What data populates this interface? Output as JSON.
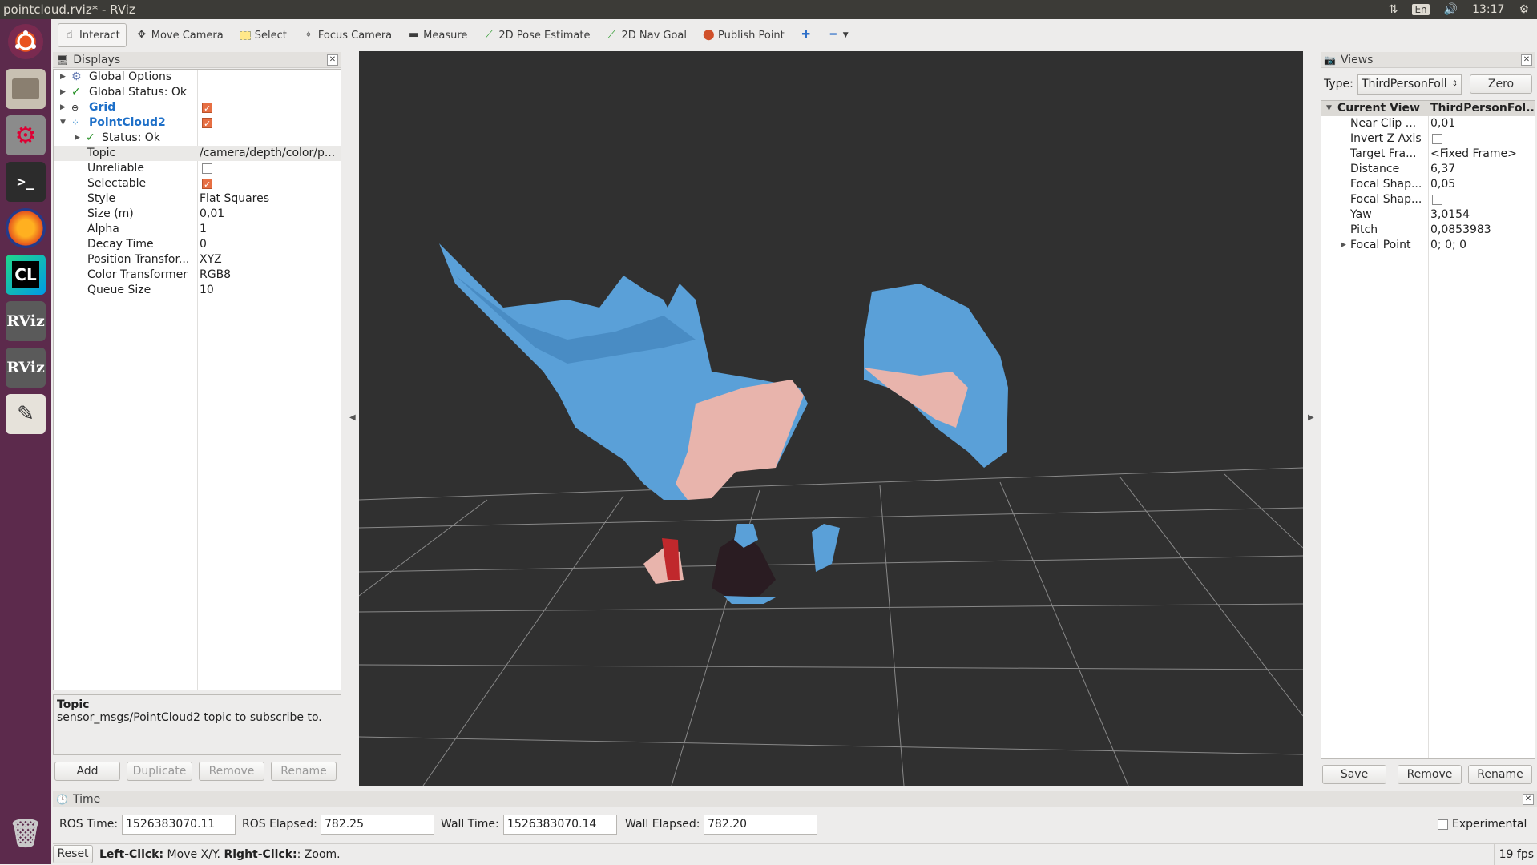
{
  "window": {
    "title": "pointcloud.rviz* - RViz"
  },
  "tray": {
    "language": "En",
    "clock": "13:17"
  },
  "launcher": {
    "items": [
      "ubuntu-icon",
      "files-icon",
      "settings-icon",
      "terminal-icon",
      "firefox-icon",
      "clion-icon",
      "rviz-icon",
      "rviz-icon",
      "text-editor-icon",
      "trash-icon"
    ],
    "clion_label": "CL",
    "rviz_label": "RViz"
  },
  "toolbar": {
    "interact": "Interact",
    "move_camera": "Move Camera",
    "select": "Select",
    "focus_camera": "Focus Camera",
    "measure": "Measure",
    "pose_estimate": "2D Pose Estimate",
    "nav_goal": "2D Nav Goal",
    "publish_point": "Publish Point"
  },
  "displays": {
    "title": "Displays",
    "global_options": "Global Options",
    "global_status": "Global Status: Ok",
    "grid": "Grid",
    "pointcloud": "PointCloud2",
    "status": "Status: Ok",
    "props": [
      {
        "k": "Topic",
        "v": "/camera/depth/color/p..."
      },
      {
        "k": "Unreliable",
        "v": ""
      },
      {
        "k": "Selectable",
        "v": ""
      },
      {
        "k": "Style",
        "v": "Flat Squares"
      },
      {
        "k": "Size (m)",
        "v": "0,01"
      },
      {
        "k": "Alpha",
        "v": "1"
      },
      {
        "k": "Decay Time",
        "v": "0"
      },
      {
        "k": "Position Transfor...",
        "v": "XYZ"
      },
      {
        "k": "Color Transformer",
        "v": "RGB8"
      },
      {
        "k": "Queue Size",
        "v": "10"
      }
    ],
    "help_title": "Topic",
    "help_text": "sensor_msgs/PointCloud2 topic to subscribe to.",
    "add": "Add",
    "duplicate": "Duplicate",
    "remove": "Remove",
    "rename": "Rename"
  },
  "views": {
    "title": "Views",
    "type_label": "Type:",
    "type_value": "ThirdPersonFoll",
    "zero": "Zero",
    "current_view": "Current View",
    "current_view_value": "ThirdPersonFol...",
    "props": [
      {
        "k": "Near Clip ...",
        "v": "0,01"
      },
      {
        "k": "Invert Z Axis",
        "v": ""
      },
      {
        "k": "Target Fra...",
        "v": "<Fixed Frame>"
      },
      {
        "k": "Distance",
        "v": "6,37"
      },
      {
        "k": "Focal Shap...",
        "v": "0,05"
      },
      {
        "k": "Focal Shap...",
        "v": ""
      },
      {
        "k": "Yaw",
        "v": "3,0154"
      },
      {
        "k": "Pitch",
        "v": "0,0853983"
      },
      {
        "k": "Focal Point",
        "v": "0; 0; 0"
      }
    ],
    "save": "Save",
    "remove": "Remove",
    "rename": "Rename"
  },
  "time": {
    "title": "Time",
    "ros_time_label": "ROS Time:",
    "ros_time": "1526383070.11",
    "ros_elapsed_label": "ROS Elapsed:",
    "ros_elapsed": "782.25",
    "wall_time_label": "Wall Time:",
    "wall_time": "1526383070.14",
    "wall_elapsed_label": "Wall Elapsed:",
    "wall_elapsed": "782.20",
    "experimental": "Experimental"
  },
  "statusbar": {
    "reset": "Reset",
    "hint_left_key": "Left-Click:",
    "hint_left": " Move X/Y. ",
    "hint_right_key": "Right-Click:",
    "hint_right": ": Zoom.",
    "fps": "19 fps"
  },
  "colors": {
    "cloud_blue": "#5aa0d8",
    "cloud_pink": "#e8b4ac",
    "bg": "#303030",
    "grid": "#8a8a8a"
  }
}
